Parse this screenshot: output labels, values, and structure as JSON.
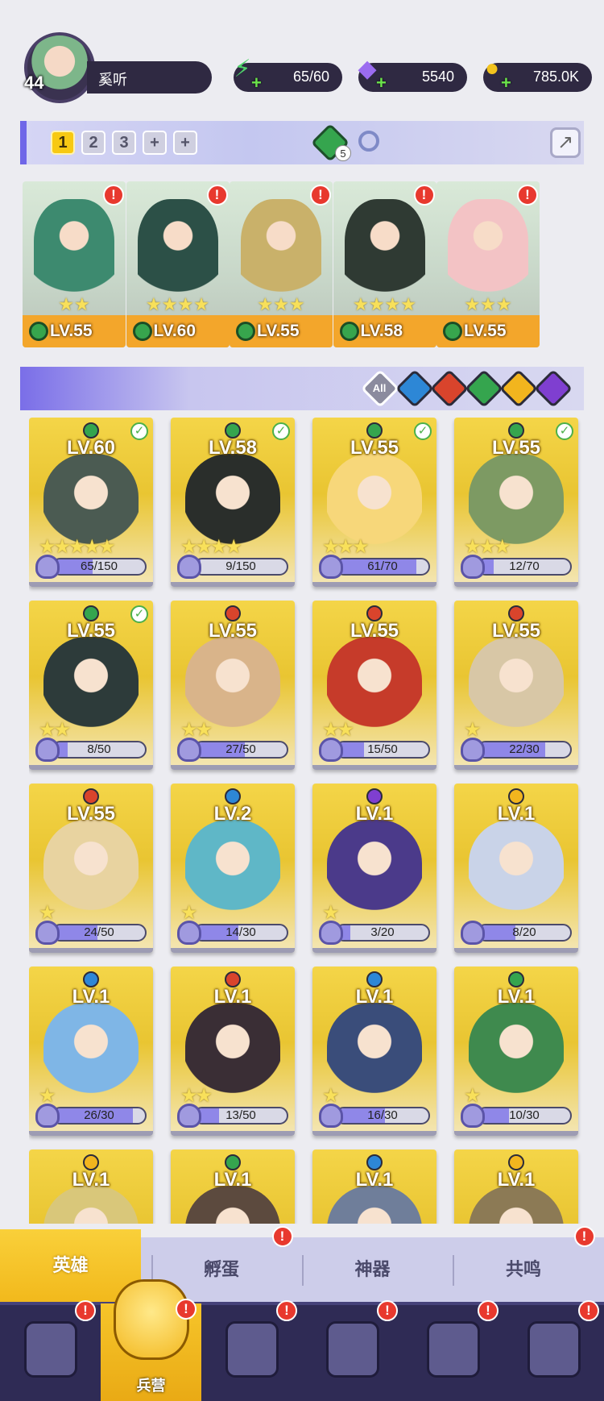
{
  "player": {
    "level": "44",
    "name": "奚听"
  },
  "resources": [
    {
      "id": "energy",
      "icon": "lightning-icon",
      "value": "65/60",
      "color": "#4fd36b"
    },
    {
      "id": "gems",
      "icon": "diamond-icon",
      "value": "5540",
      "color": "#9b6cf0"
    },
    {
      "id": "gold",
      "icon": "coin-icon",
      "value": "785.0K",
      "color": "#f2c31e"
    }
  ],
  "team_tabs": [
    {
      "label": "1",
      "active": true
    },
    {
      "label": "2",
      "active": false
    },
    {
      "label": "3",
      "active": false
    },
    {
      "label": "+",
      "active": false
    },
    {
      "label": "+",
      "active": false
    }
  ],
  "team_gem_count": "5",
  "team": [
    {
      "level": "LV.55",
      "stars": "★★",
      "color": "#3d8a6f"
    },
    {
      "level": "LV.60",
      "stars": "★★★★",
      "color": "#2c5047"
    },
    {
      "level": "LV.55",
      "stars": "★★★",
      "color": "#c9b16a"
    },
    {
      "level": "LV.58",
      "stars": "★★★★",
      "color": "#2f3a33"
    },
    {
      "level": "LV.55",
      "stars": "★★★",
      "color": "#f3c3c5"
    }
  ],
  "filters": [
    {
      "name": "all",
      "label": "All",
      "color": "#8b8b9e"
    },
    {
      "name": "water",
      "color": "#2d87d6"
    },
    {
      "name": "fire",
      "color": "#d9442c"
    },
    {
      "name": "nature",
      "color": "#35a54e"
    },
    {
      "name": "light",
      "color": "#f2b51e"
    },
    {
      "name": "dark",
      "color": "#7f3fd0"
    }
  ],
  "heroes": [
    {
      "level": "LV.60",
      "element": "#35a54e",
      "check": true,
      "stars": "★★★★★",
      "progress": "65/150",
      "ratio": 0.43,
      "art": "#4b5b52"
    },
    {
      "level": "LV.58",
      "element": "#35a54e",
      "check": true,
      "stars": "★★★★",
      "progress": "9/150",
      "ratio": 0.06,
      "art": "#2a2e2b"
    },
    {
      "level": "LV.55",
      "element": "#35a54e",
      "check": true,
      "stars": "★★★",
      "progress": "61/70",
      "ratio": 0.87,
      "art": "#f7d77a"
    },
    {
      "level": "LV.55",
      "element": "#35a54e",
      "check": true,
      "stars": "★★★",
      "progress": "12/70",
      "ratio": 0.17,
      "art": "#7d9a63"
    },
    {
      "level": "LV.55",
      "element": "#35a54e",
      "check": true,
      "stars": "★★",
      "progress": "8/50",
      "ratio": 0.16,
      "art": "#2d3b3a"
    },
    {
      "level": "LV.55",
      "element": "#d9442c",
      "check": false,
      "stars": "★★",
      "progress": "27/50",
      "ratio": 0.54,
      "art": "#d9b48a"
    },
    {
      "level": "LV.55",
      "element": "#d9442c",
      "check": false,
      "stars": "★★",
      "progress": "15/50",
      "ratio": 0.3,
      "art": "#c63b2a"
    },
    {
      "level": "LV.55",
      "element": "#d9442c",
      "check": false,
      "stars": "★",
      "progress": "22/30",
      "ratio": 0.73,
      "art": "#d8c7a6"
    },
    {
      "level": "LV.55",
      "element": "#d9442c",
      "check": false,
      "stars": "★",
      "progress": "24/50",
      "ratio": 0.48,
      "art": "#e8d3a0"
    },
    {
      "level": "LV.2",
      "element": "#2d87d6",
      "check": false,
      "stars": "★",
      "progress": "14/30",
      "ratio": 0.47,
      "art": "#5fb7c7"
    },
    {
      "level": "LV.1",
      "element": "#7f3fd0",
      "check": false,
      "stars": "★",
      "progress": "3/20",
      "ratio": 0.15,
      "art": "#4b3a8a"
    },
    {
      "level": "LV.1",
      "element": "#f2b51e",
      "check": false,
      "stars": "",
      "progress": "8/20",
      "ratio": 0.4,
      "art": "#c9d3e8"
    },
    {
      "level": "LV.1",
      "element": "#2d87d6",
      "check": false,
      "stars": "★",
      "progress": "26/30",
      "ratio": 0.87,
      "art": "#7fb6e6"
    },
    {
      "level": "LV.1",
      "element": "#d9442c",
      "check": false,
      "stars": "★★",
      "progress": "13/50",
      "ratio": 0.26,
      "art": "#3a2e35"
    },
    {
      "level": "LV.1",
      "element": "#2d87d6",
      "check": false,
      "stars": "★",
      "progress": "16/30",
      "ratio": 0.53,
      "art": "#3a4d7a"
    },
    {
      "level": "LV.1",
      "element": "#35a54e",
      "check": false,
      "stars": "★",
      "progress": "10/30",
      "ratio": 0.33,
      "art": "#3f8a4e"
    },
    {
      "level": "LV.1",
      "element": "#f2b51e",
      "check": false,
      "stars": "",
      "progress": "",
      "ratio": 0,
      "art": "#d9c77a"
    },
    {
      "level": "LV.1",
      "element": "#35a54e",
      "check": false,
      "stars": "",
      "progress": "",
      "ratio": 0,
      "art": "#5c4a3e"
    },
    {
      "level": "LV.1",
      "element": "#2d87d6",
      "check": false,
      "stars": "",
      "progress": "",
      "ratio": 0,
      "art": "#6f7e9a"
    },
    {
      "level": "LV.1",
      "element": "#f2b51e",
      "check": false,
      "stars": "",
      "progress": "",
      "ratio": 0,
      "art": "#8c7a55"
    }
  ],
  "subtabs": [
    {
      "label": "英雄",
      "active": true,
      "alert": false
    },
    {
      "label": "孵蛋",
      "active": false,
      "alert": true
    },
    {
      "label": "神器",
      "active": false,
      "alert": false
    },
    {
      "label": "共鸣",
      "active": false,
      "alert": true
    }
  ],
  "nav": [
    {
      "icon": "cards-icon",
      "label": "",
      "active": false
    },
    {
      "icon": "barracks-icon",
      "label": "兵营",
      "active": true
    },
    {
      "icon": "map-icon",
      "label": "",
      "active": false
    },
    {
      "icon": "castle-icon",
      "label": "",
      "active": false
    },
    {
      "icon": "guild-icon",
      "label": "",
      "active": false
    },
    {
      "icon": "shield-icon",
      "label": "",
      "active": false
    }
  ],
  "alert_symbol": "!"
}
